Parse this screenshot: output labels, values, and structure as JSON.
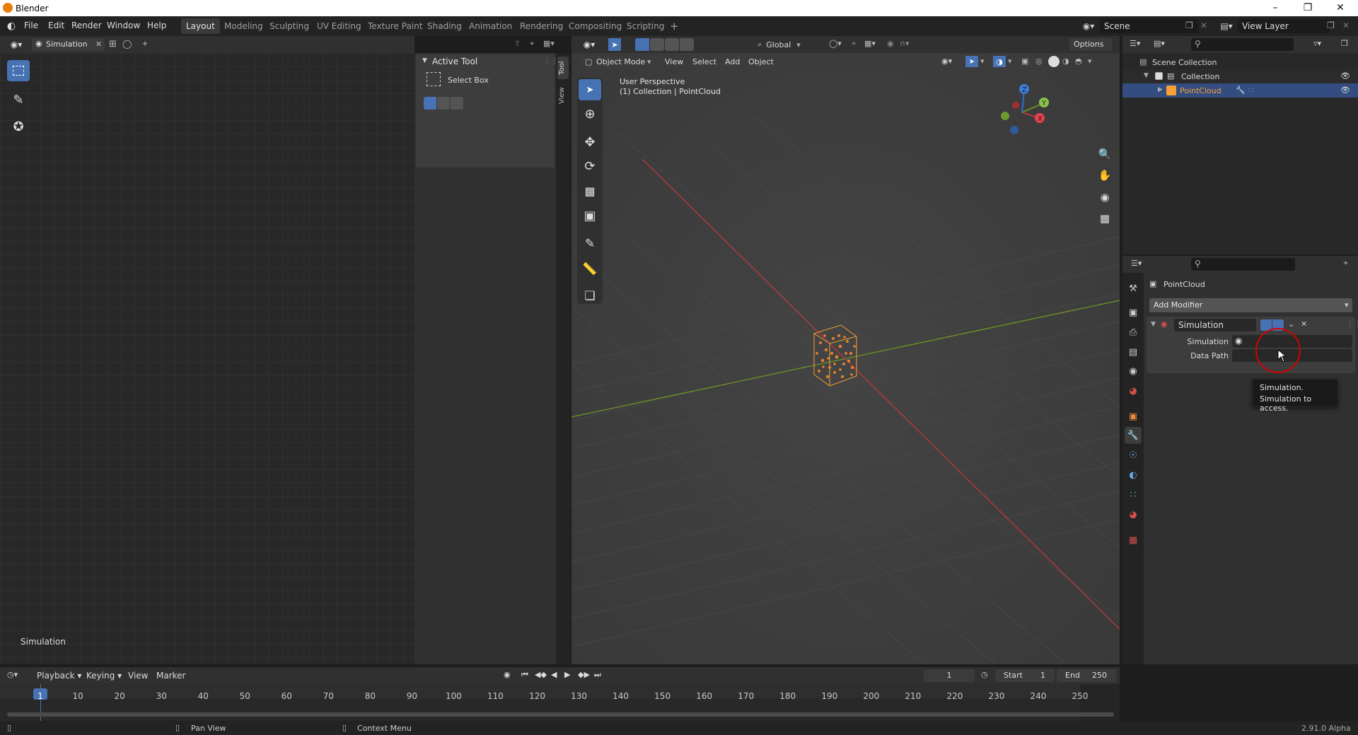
{
  "window": {
    "title": "Blender"
  },
  "menu": [
    "File",
    "Edit",
    "Render",
    "Window",
    "Help"
  ],
  "workspaces": [
    "Layout",
    "Modeling",
    "Sculpting",
    "UV Editing",
    "Texture Paint",
    "Shading",
    "Animation",
    "Rendering",
    "Compositing",
    "Scripting"
  ],
  "active_workspace": "Layout",
  "scene": "Scene",
  "view_layer": "View Layer",
  "left_editor": {
    "datablock": "Simulation",
    "footer_label": "Simulation"
  },
  "sidebar": {
    "section": "Active Tool",
    "tool_name": "Select Box",
    "tabs": [
      "Tool",
      "View"
    ]
  },
  "viewport": {
    "mode": "Object Mode",
    "menus": [
      "View",
      "Select",
      "Add",
      "Object"
    ],
    "orientation": "Global",
    "options": "Options",
    "perspective": "User Perspective",
    "collection_info": "(1) Collection | PointCloud",
    "gizmo": {
      "x": "X",
      "y": "Y",
      "z": "Z"
    }
  },
  "outliner": {
    "items": [
      {
        "label": "Scene Collection"
      },
      {
        "label": "Collection"
      },
      {
        "label": "PointCloud"
      }
    ]
  },
  "properties": {
    "object": "PointCloud",
    "add_modifier": "Add Modifier",
    "modifier": {
      "name": "Simulation",
      "simulation_label": "Simulation",
      "data_path_label": "Data Path"
    },
    "tooltip": {
      "line1": "Simulation.",
      "line2": "Simulation to access."
    }
  },
  "timeline": {
    "menus": [
      "Playback",
      "Keying",
      "View",
      "Marker"
    ],
    "current_frame": "1",
    "start_label": "Start",
    "start": "1",
    "end_label": "End",
    "end": "250",
    "ticks": [
      "1",
      "10",
      "20",
      "30",
      "40",
      "50",
      "60",
      "70",
      "80",
      "90",
      "100",
      "110",
      "120",
      "130",
      "140",
      "150",
      "160",
      "170",
      "180",
      "190",
      "200",
      "210",
      "220",
      "230",
      "240",
      "250"
    ]
  },
  "statusbar": {
    "pan": "Pan View",
    "context": "Context Menu",
    "version": "2.91.0 Alpha"
  },
  "colors": {
    "accent": "#4772b3",
    "selected_object": "#f7a035",
    "x_axis": "#b5383d",
    "y_axis": "#6b8f24",
    "annotation": "#d40000"
  }
}
